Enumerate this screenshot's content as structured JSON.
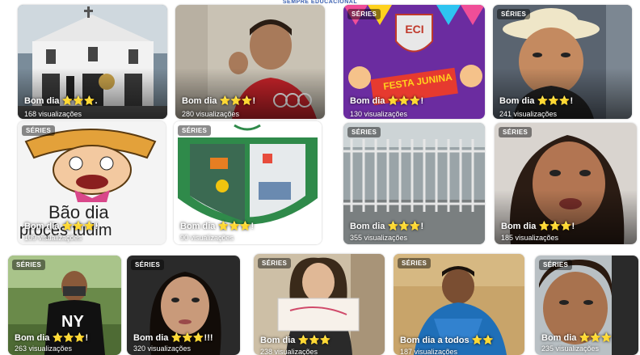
{
  "header": {
    "partial_text": "SEMPRE EDUCACIONAL"
  },
  "series_badge": "SÉRIES",
  "cards": [
    {
      "id": "c1",
      "title": "Bom dia ⭐⭐⭐.",
      "views": "168 visualizações"
    },
    {
      "id": "c2",
      "title": "Bom dia ⭐⭐⭐!",
      "views": "280 visualizações"
    },
    {
      "id": "c3",
      "title": "Bom dia ⭐⭐⭐!",
      "views": "130 visualizações"
    },
    {
      "id": "c4",
      "title": "Bom dia ⭐⭐⭐!",
      "views": "241 visualizações"
    },
    {
      "id": "c5",
      "title": "Bom dia ⭐⭐⭐!",
      "views": "109 visualizações"
    },
    {
      "id": "c6",
      "title": "Bom dia ⭐⭐⭐!",
      "views": "90 visualizações"
    },
    {
      "id": "c7",
      "title": "Bom dia ⭐⭐⭐!",
      "views": "355 visualizações"
    },
    {
      "id": "c8",
      "title": "Bom dia ⭐⭐⭐!",
      "views": "185 visualizações"
    },
    {
      "id": "c9",
      "title": "Bom dia ⭐⭐⭐!",
      "views": "263 visualizações"
    },
    {
      "id": "c10",
      "title": "Bom dia ⭐⭐⭐!!!",
      "views": "320 visualizações"
    },
    {
      "id": "c11",
      "title": "Bom dia ⭐⭐⭐",
      "views": "238 visualizações"
    },
    {
      "id": "c12",
      "title": "Bom dia a todos ⭐⭐",
      "views": "187 visualizações"
    },
    {
      "id": "c13",
      "title": "Bom dia ⭐⭐⭐",
      "views": "235 visualizações"
    }
  ],
  "thumb_text": {
    "card5_caption_line1": "Bão dia",
    "card5_caption_line2": "proçês tudim",
    "card3_banner": "FESTA JUNINA",
    "card3_logo": "ECI"
  },
  "colors": {
    "star": "#ffd21e",
    "badge_bg": "rgba(0,0,0,0.45)",
    "text": "#ffffff"
  }
}
